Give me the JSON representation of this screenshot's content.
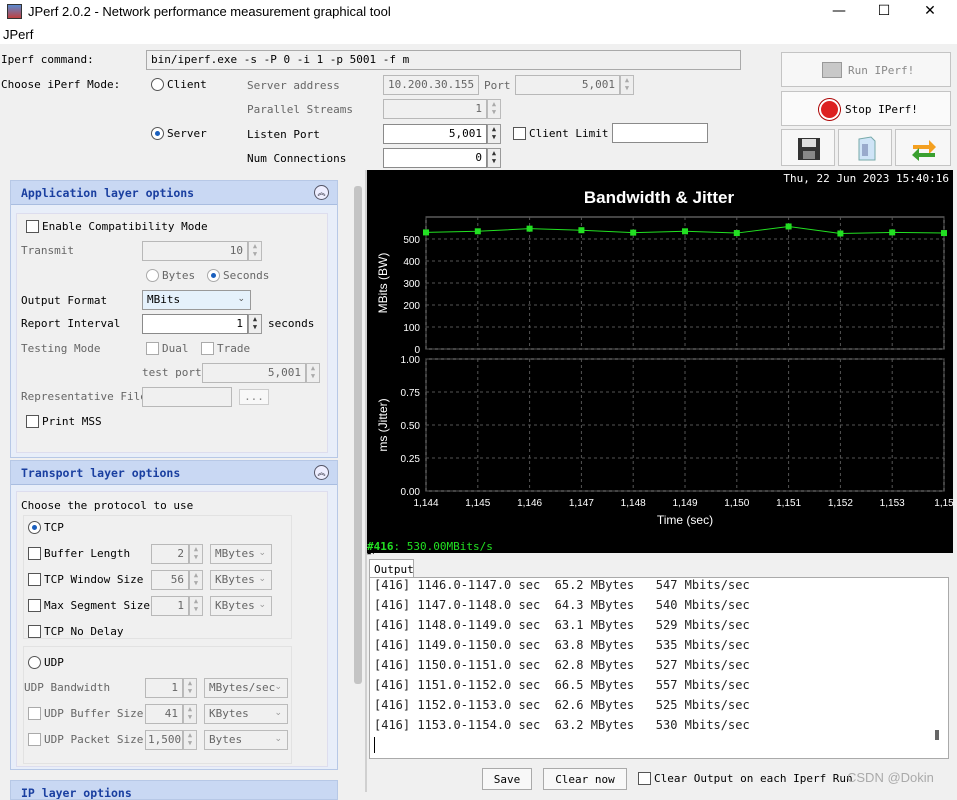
{
  "window": {
    "title": "JPerf 2.0.2 - Network performance measurement graphical tool",
    "minimize": "—",
    "maximize": "☐",
    "close": "✕"
  },
  "menu": {
    "label": "JPerf"
  },
  "top": {
    "cmd_label": "Iperf command:",
    "cmd_value": "bin/iperf.exe -s -P 0 -i 1 -p 5001 -f m",
    "mode_label": "Choose iPerf Mode:",
    "client_label": "Client",
    "server_label": "Server",
    "server_address_label": "Server address",
    "server_address_value": "10.200.30.155",
    "port_label": "Port",
    "port_value": "5,001",
    "parallel_label": "Parallel Streams",
    "parallel_value": "1",
    "listen_port_label": "Listen Port",
    "listen_port_value": "5,001",
    "client_limit_label": "Client Limit",
    "num_conn_label": "Num Connections",
    "num_conn_value": "0"
  },
  "actions": {
    "run": "Run IPerf!",
    "stop": "Stop IPerf!"
  },
  "app_layer": {
    "title": "Application layer options",
    "compat": "Enable Compatibility Mode",
    "transmit_label": "Transmit",
    "transmit_value": "10",
    "bytes": "Bytes",
    "seconds": "Seconds",
    "output_format_label": "Output Format",
    "output_format_value": "MBits",
    "report_interval_label": "Report Interval",
    "report_interval_value": "1",
    "report_interval_unit": "seconds",
    "testing_mode_label": "Testing Mode",
    "dual": "Dual",
    "trade": "Trade",
    "test_port_label": "test port",
    "test_port_value": "5,001",
    "rep_file_label": "Representative File",
    "rep_file_btn": "...",
    "print_mss": "Print MSS"
  },
  "transport": {
    "title": "Transport layer options",
    "choose": "Choose the protocol to use",
    "tcp": "TCP",
    "buffer_length": "Buffer Length",
    "buffer_length_value": "2",
    "buffer_length_unit": "MBytes",
    "tcp_window": "TCP Window Size",
    "tcp_window_value": "56",
    "tcp_window_unit": "KBytes",
    "mss": "Max Segment Size",
    "mss_value": "1",
    "mss_unit": "KBytes",
    "no_delay": "TCP No Delay",
    "udp": "UDP",
    "udp_bw": "UDP Bandwidth",
    "udp_bw_value": "1",
    "udp_bw_unit": "MBytes/sec",
    "udp_buf": "UDP Buffer Size",
    "udp_buf_value": "41",
    "udp_buf_unit": "KBytes",
    "udp_pkt": "UDP Packet Size",
    "udp_pkt_value": "1,500",
    "udp_pkt_unit": "Bytes"
  },
  "ip_layer": {
    "title": "IP layer options"
  },
  "chart_header": {
    "date": "Thu, 22 Jun 2023 15:40:16"
  },
  "chart_data": {
    "type": "line",
    "title": "Bandwidth & Jitter",
    "xlabel": "Time (sec)",
    "x": [
      1144,
      1145,
      1146,
      1147,
      1148,
      1149,
      1150,
      1151,
      1152,
      1153,
      1154
    ],
    "x_tick_labels": [
      "1,144",
      "1,145",
      "1,146",
      "1,147",
      "1,148",
      "1,149",
      "1,150",
      "1,151",
      "1,152",
      "1,153",
      "1,15"
    ],
    "bandwidth": {
      "ylabel": "MBits (BW)",
      "ylim": [
        0,
        600
      ],
      "yticks": [
        "0",
        "100",
        "200",
        "300",
        "400",
        "500"
      ],
      "values": [
        530,
        535,
        547,
        540,
        529,
        535,
        527,
        557,
        525,
        530,
        527
      ],
      "color": "#22e022"
    },
    "jitter": {
      "ylabel": "ms (Jitter)",
      "ylim": [
        0,
        1.0
      ],
      "yticks": [
        "0.00",
        "0.25",
        "0.50",
        "0.75",
        "1.00"
      ]
    },
    "grid": true
  },
  "status": {
    "prefix": "#416",
    "text": ": 530.00MBits/s"
  },
  "output": {
    "tab": "Output",
    "lines": [
      "[416] 1146.0-1147.0 sec  65.2 MBytes   547 Mbits/sec",
      "[416] 1147.0-1148.0 sec  64.3 MBytes   540 Mbits/sec",
      "[416] 1148.0-1149.0 sec  63.1 MBytes   529 Mbits/sec",
      "[416] 1149.0-1150.0 sec  63.8 MBytes   535 Mbits/sec",
      "[416] 1150.0-1151.0 sec  62.8 MBytes   527 Mbits/sec",
      "[416] 1151.0-1152.0 sec  66.5 MBytes   557 Mbits/sec",
      "[416] 1152.0-1153.0 sec  62.6 MBytes   525 Mbits/sec",
      "[416] 1153.0-1154.0 sec  63.2 MBytes   530 Mbits/sec"
    ],
    "save": "Save",
    "clear": "Clear now",
    "clear_each": "Clear Output on each Iperf Run"
  },
  "watermark": "CSDN @Dokin",
  "colors": {
    "accent_blue": "#1a3fa0",
    "panel_header": "#c9d8f3",
    "chart_bg": "#000000",
    "line_green": "#22e022",
    "status_green": "#22e022"
  }
}
